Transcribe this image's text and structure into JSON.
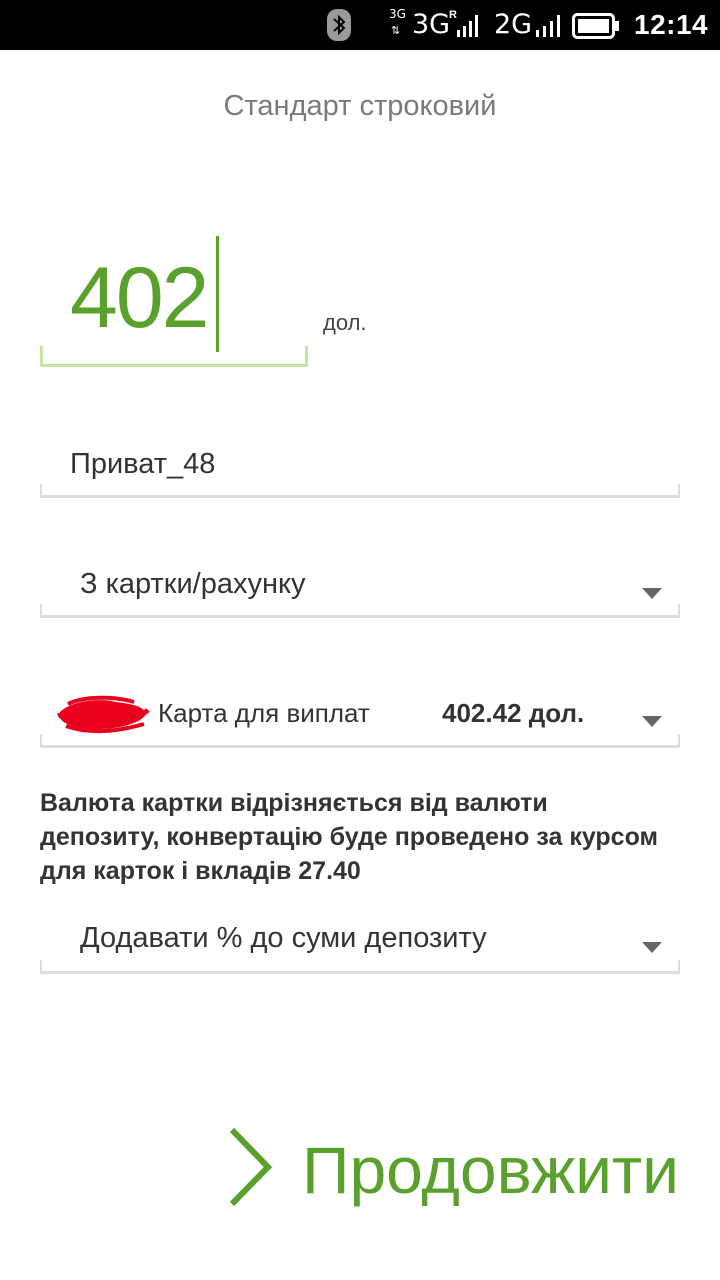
{
  "status_bar": {
    "net1_small": "3G",
    "net1": "3G",
    "net1_roaming": "R",
    "net2": "2G",
    "time": "12:14"
  },
  "header": {
    "title": "Стандарт строковий"
  },
  "amount": {
    "value": "402",
    "unit": "дол."
  },
  "deposit_name": {
    "value": "Приват_48"
  },
  "source_select": {
    "selected": "З картки/рахунку"
  },
  "card_select": {
    "selected": "Карта для виплат",
    "balance": "402.42 дол."
  },
  "notice": {
    "text": "Валюта картки відрізняється від валюти депозиту, конвертацію буде проведено за курсом для карток і вкладів 27.40"
  },
  "interest_select": {
    "selected": "Додавати % до суми депозиту"
  },
  "actions": {
    "continue_label": "Продовжити"
  },
  "colors": {
    "accent": "#5aa02c",
    "underline": "#dddddd",
    "underline_active": "#c7e6a6",
    "redaction": "#e8001c"
  },
  "icons": {
    "bluetooth": "bluetooth-icon",
    "signal": "signal-icon",
    "battery": "battery-icon",
    "dropdown": "chevron-down-icon",
    "continue": "chevron-right-icon"
  }
}
